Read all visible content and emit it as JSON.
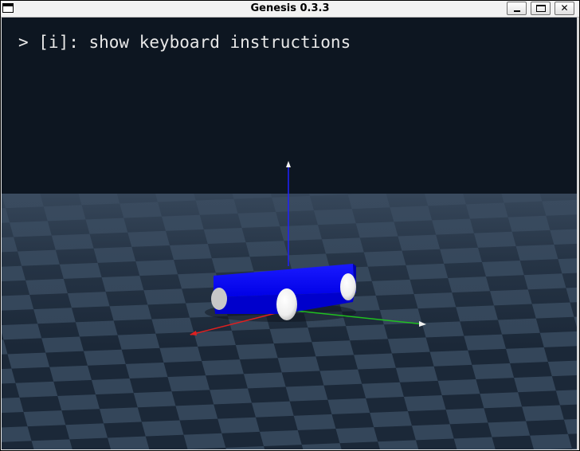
{
  "window": {
    "title": "Genesis 0.3.3",
    "buttons": {
      "minimize": "minimize",
      "maximize": "maximize",
      "close": "✕"
    }
  },
  "viewer": {
    "hint_text": "> [i]: show keyboard instructions",
    "colors": {
      "sky": "#0d1621",
      "floor_light": "#34465a",
      "floor_dark": "#1b2838",
      "robot_body": "#0000ff",
      "wheel": "#f2f2f2",
      "axis_x": "#e02020",
      "axis_y": "#20c020",
      "axis_z": "#2020ff"
    }
  }
}
